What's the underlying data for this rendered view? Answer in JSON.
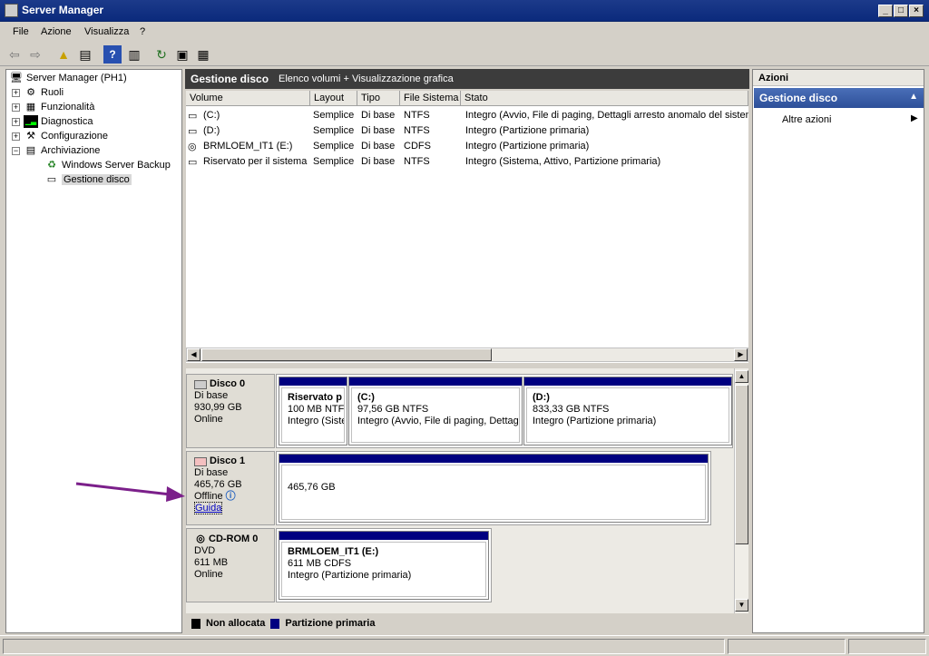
{
  "window": {
    "title": "Server Manager",
    "min": "_",
    "max": "□",
    "close": "×"
  },
  "menu": [
    "File",
    "Azione",
    "Visualizza",
    "?"
  ],
  "tree": {
    "root": "Server Manager (PH1)",
    "items": [
      {
        "label": "Ruoli",
        "expander": "+"
      },
      {
        "label": "Funzionalità",
        "expander": "+"
      },
      {
        "label": "Diagnostica",
        "expander": "+"
      },
      {
        "label": "Configurazione",
        "expander": "+"
      },
      {
        "label": "Archiviazione",
        "expander": "−"
      },
      {
        "label": "Windows Server Backup"
      },
      {
        "label": "Gestione disco"
      }
    ]
  },
  "main": {
    "title": "Gestione disco",
    "subtitle": "Elenco volumi + Visualizzazione grafica"
  },
  "volumes": {
    "columns": [
      "Volume",
      "Layout",
      "Tipo",
      "File Sistema",
      "Stato"
    ],
    "rows": [
      [
        "(C:)",
        "Semplice",
        "Di base",
        "NTFS",
        "Integro (Avvio, File di paging, Dettagli arresto anomalo del sistem"
      ],
      [
        "(D:)",
        "Semplice",
        "Di base",
        "NTFS",
        "Integro (Partizione primaria)"
      ],
      [
        "BRMLOEM_IT1 (E:)",
        "Semplice",
        "Di base",
        "CDFS",
        "Integro (Partizione primaria)"
      ],
      [
        "Riservato per il sistema",
        "Semplice",
        "Di base",
        "NTFS",
        "Integro (Sistema, Attivo, Partizione primaria)"
      ]
    ]
  },
  "disks": {
    "d0": {
      "name": "Disco 0",
      "type": "Di base",
      "size": "930,99 GB",
      "status": "Online",
      "p1": {
        "name": "Riservato p",
        "size": "100 MB NTFS",
        "status": "Integro (Siste"
      },
      "p2": {
        "name": "(C:)",
        "size": "97,56 GB NTFS",
        "status": "Integro (Avvio, File di paging, Dettag"
      },
      "p3": {
        "name": "(D:)",
        "size": "833,33 GB NTFS",
        "status": "Integro (Partizione primaria)"
      }
    },
    "d1": {
      "name": "Disco 1",
      "type": "Di base",
      "size": "465,76 GB",
      "status": "Offline",
      "help": "Guida",
      "p1": {
        "size": "465,76 GB"
      }
    },
    "cd": {
      "name": "CD-ROM 0",
      "type": "DVD",
      "size": "611 MB",
      "status": "Online",
      "p1": {
        "name": "BRMLOEM_IT1  (E:)",
        "size": "611 MB CDFS",
        "status": "Integro (Partizione primaria)"
      }
    }
  },
  "legend": {
    "unallocated": "Non allocata",
    "primary": "Partizione primaria"
  },
  "colors": {
    "primary": "#000080",
    "unallocated": "#000000",
    "arrow": "#7b1f8a"
  },
  "actions": {
    "header": "Azioni",
    "selected": "Gestione disco",
    "more": "Altre azioni"
  }
}
